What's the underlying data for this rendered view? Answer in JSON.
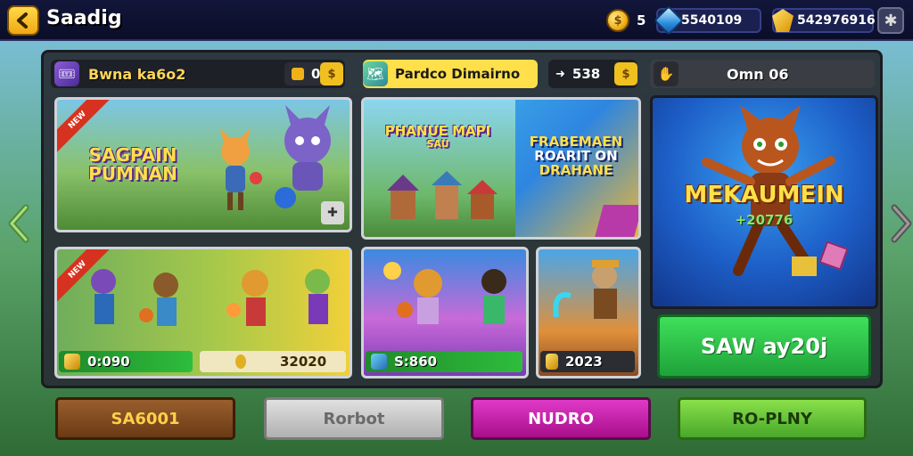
{
  "header": {
    "title": "Saadig",
    "coins": "5",
    "gems": "5540109",
    "gold": "542976916",
    "coin_symbol": "$"
  },
  "left_section": {
    "title": "Bwna ka6o2",
    "badge_value": "01"
  },
  "middle_section": {
    "title": "Pardco Dimairno",
    "badge_value": "538"
  },
  "right_section": {
    "title": "Omn 06"
  },
  "cards": {
    "top_left": {
      "title_line1": "SAGPAIN",
      "title_line2": "PUMNAN"
    },
    "top_middle": {
      "title_line1": "PHANUE MAPI",
      "title_line2": "SAU",
      "subtitle_line1": "FRABEMAEN",
      "subtitle_line2": "ROARIT ON",
      "subtitle_line3": "DRAHANE"
    },
    "featured": {
      "title": "MEKAUMEIN",
      "number": "+20776",
      "button_label": "SAW ay20j"
    },
    "bottom_left": {
      "stat_a": "0:090",
      "stat_b": "32020"
    },
    "bottom_middle_a": {
      "stat": "S:860"
    },
    "bottom_middle_b": {
      "stat": "2023"
    }
  },
  "bottom_buttons": [
    {
      "label": "SA6001",
      "color": "#7a4a22"
    },
    {
      "label": "Rorbot",
      "color": "#c9c9c9"
    },
    {
      "label": "NUDRO",
      "color": "#c21aa8"
    },
    {
      "label": "RO-PLNY",
      "color": "#5cc23a"
    }
  ],
  "icons": {
    "back": "back-arrow-icon",
    "coin": "coin-icon",
    "gem": "gem-icon",
    "gold": "gold-icon",
    "settings": "settings-icon",
    "prev": "chevron-left-icon",
    "next": "chevron-right-icon"
  }
}
